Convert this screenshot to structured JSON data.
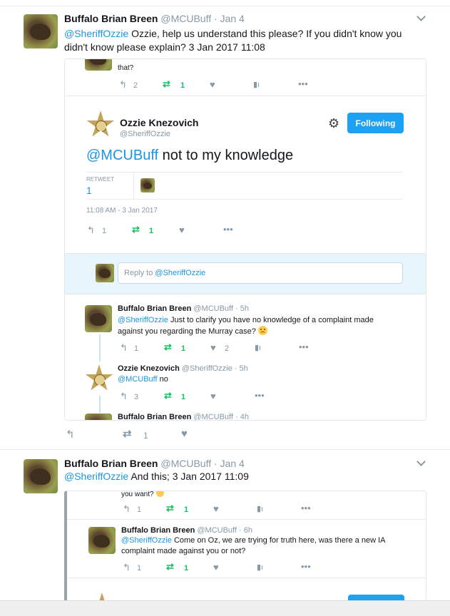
{
  "tweet1": {
    "name": "Buffalo Brian Breen",
    "handle": "@MCUBuff",
    "date": "· Jan 4",
    "mention": "@SheriffOzzie",
    "text_line1": " Ozzie, help us understand this please? If you didn't know you",
    "text_line2": "didn't know please explain? 3 Jan 2017 11:08",
    "actions": {
      "retweets": "1"
    },
    "embed": {
      "cut_text": "that?",
      "top_actions": {
        "replies": "2",
        "retweets": "1"
      },
      "main": {
        "name": "Ozzie Knezovich",
        "handle": "@SheriffOzzie",
        "follow_label": "Following",
        "mention": "@MCUBuff",
        "text": " not to my knowledge",
        "retweet_label": "RETWEET",
        "retweet_count": "1",
        "timestamp": "11:08 AM - 3 Jan 2017",
        "actions": {
          "replies": "1",
          "retweets": "1"
        }
      },
      "reply_placeholder": "Reply to ",
      "reply_handle": "@SheriffOzzie",
      "replies": [
        {
          "name": "Buffalo Brian Breen",
          "handle": "@MCUBuff · 5h",
          "mention": "@SheriffOzzie",
          "text_line1": " Just to clarify you have no knowledge of a complaint made",
          "text_line2": "against you regarding the Murray case?",
          "actions": {
            "replies": "1",
            "retweets": "1",
            "likes": "2"
          }
        },
        {
          "name": "Ozzie Knezovich",
          "handle": "@SheriffOzzie · 5h",
          "mention": "@MCUBuff",
          "text_line1": " no",
          "actions": {
            "replies": "3",
            "retweets": "1"
          }
        },
        {
          "name": "Buffalo Brian Breen",
          "handle": "@MCUBuff · 4h"
        }
      ]
    }
  },
  "tweet2": {
    "name": "Buffalo Brian Breen",
    "handle": "@MCUBuff",
    "date": "· Jan 4",
    "mention": "@SheriffOzzie",
    "text_line1": " And this; 3 Jan 2017 11:09",
    "embed": {
      "cut_text": "you want?",
      "top_actions": {
        "replies": "1",
        "retweets": "1"
      },
      "reply": {
        "name": "Buffalo Brian Breen",
        "handle": "@MCUBuff · 6h",
        "mention": "@SheriffOzzie",
        "text_line1": " Come on Oz, we are trying for truth here, was there a new IA",
        "text_line2": "complaint made against you or not?",
        "actions": {
          "replies": "1",
          "retweets": "1"
        }
      }
    }
  },
  "icons": {
    "reply": "reply-icon",
    "retweet": "retweet-icon",
    "like": "heart-icon",
    "analytics": "analytics-icon",
    "more": "more-icon",
    "chevron": "chevron-down-icon",
    "gear": "gear-icon"
  },
  "colors": {
    "link": "#1b95e0",
    "retweet_green": "#17bf63",
    "follow_button": "#1da1f2",
    "meta_grey": "#8899a6",
    "reply_bar": "#e8f5fd"
  }
}
